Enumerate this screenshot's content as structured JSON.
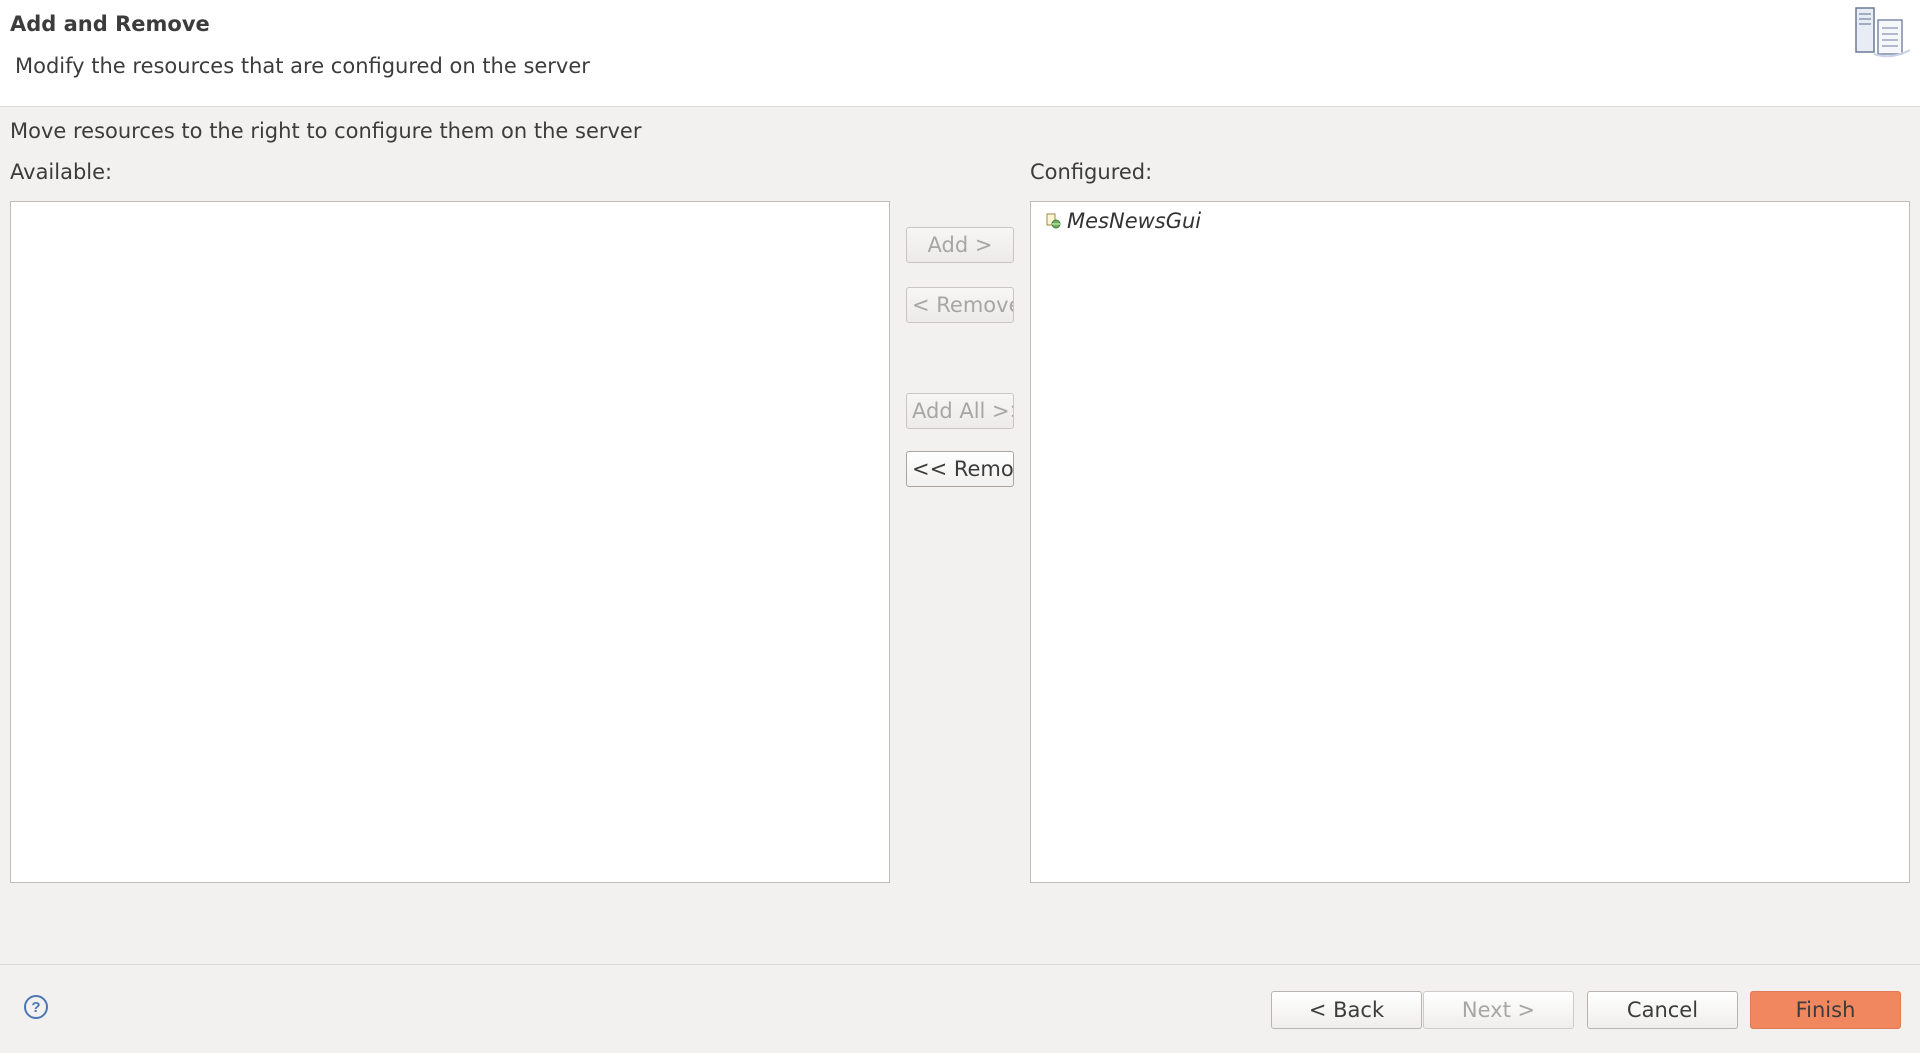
{
  "header": {
    "title": "Add and Remove",
    "subtitle": "Modify the resources that are configured on the server",
    "icon": "server-icon"
  },
  "instruction": "Move resources to the right to configure them on the server",
  "available": {
    "label": "Available:",
    "items": []
  },
  "configured": {
    "label": "Configured:",
    "items": [
      {
        "label": "MesNewsGui",
        "icon": "web-module-icon"
      }
    ]
  },
  "transfer_buttons": {
    "add": "Add >",
    "remove": "< Remove",
    "add_all": "Add All >>",
    "remove_all": "<< Remove All"
  },
  "footer": {
    "help_icon": "help-icon",
    "back": "< Back",
    "next": "Next >",
    "cancel": "Cancel",
    "finish": "Finish"
  },
  "colors": {
    "finish_button": "#f0875e",
    "help_icon": "#4a78b4",
    "banner_background": "#ffffff",
    "dialog_background": "#f2f1f0"
  }
}
